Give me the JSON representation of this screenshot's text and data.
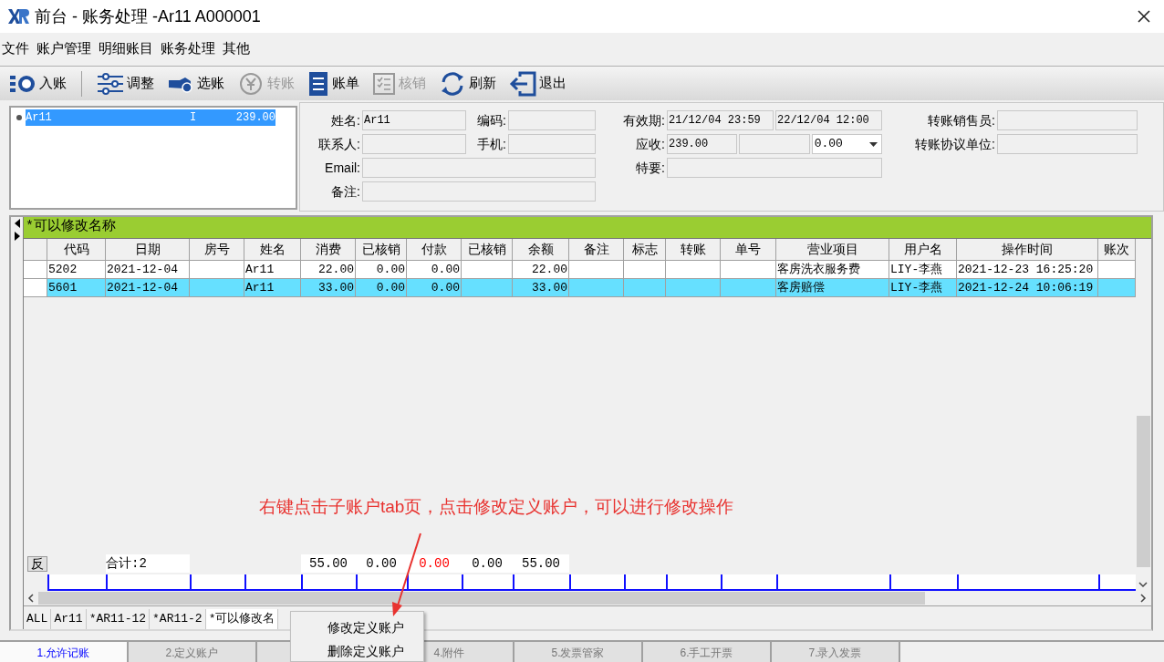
{
  "window": {
    "title": "前台 - 账务处理 -Ar11  A000001"
  },
  "menu": [
    "文件",
    "账户管理",
    "明细账目",
    "账务处理",
    "其他"
  ],
  "toolbar": [
    {
      "label": "入账",
      "disabled": false
    },
    {
      "label": "调整",
      "disabled": false
    },
    {
      "label": "选账",
      "disabled": false
    },
    {
      "label": "转账",
      "disabled": true
    },
    {
      "label": "账单",
      "disabled": false
    },
    {
      "label": "核销",
      "disabled": true
    },
    {
      "label": "刷新",
      "disabled": false
    },
    {
      "label": "退出",
      "disabled": false
    }
  ],
  "account_list": [
    {
      "name": "Ar11",
      "flag": "I",
      "amount": "239.00",
      "selected": true
    }
  ],
  "form": {
    "groups": [
      [
        {
          "label": "姓名:",
          "kind": "normal",
          "inputs": [
            {
              "kind": "text",
              "value": "Ar11"
            }
          ]
        },
        {
          "label": "联系人:",
          "kind": "normal",
          "inputs": [
            {
              "kind": "text"
            }
          ]
        },
        {
          "label": "Email:",
          "kind": "wide",
          "inputs": [
            {
              "kind": "text"
            }
          ]
        },
        {
          "label": "备注:",
          "kind": "wide",
          "inputs": [
            {
              "kind": "text"
            }
          ]
        }
      ],
      [
        {
          "label": "编码:",
          "kind": "normal",
          "inputs": [
            {
              "kind": "text"
            }
          ]
        },
        {
          "label": "手机:",
          "kind": "normal",
          "inputs": [
            {
              "kind": "text"
            }
          ]
        }
      ],
      [
        {
          "label": "有效期:",
          "kind": "normal",
          "inputs": [
            {
              "kind": "text",
              "value": "21/12/04 23:59"
            },
            {
              "kind": "text",
              "value": "22/12/04 12:00"
            }
          ]
        },
        {
          "label": "应收:",
          "kind": "normal",
          "inputs": [
            {
              "kind": "text",
              "value": "239.00"
            },
            {
              "kind": "text"
            },
            {
              "kind": "dropdown",
              "value": "0.00"
            }
          ]
        },
        {
          "label": "特要:",
          "kind": "normal",
          "inputs": [
            {
              "kind": "text"
            }
          ]
        }
      ],
      [
        {
          "label": "转账销售员:",
          "kind": "normal",
          "inputs": [
            {
              "kind": "text"
            }
          ]
        },
        {
          "label": "转账协议单位:",
          "kind": "normal",
          "inputs": [
            {
              "kind": "text"
            }
          ]
        }
      ]
    ]
  },
  "grid": {
    "title": "*可以修改名称",
    "columns": [
      {
        "label": "代码",
        "kind": "text"
      },
      {
        "label": "日期",
        "kind": "text"
      },
      {
        "label": "房号",
        "kind": "text"
      },
      {
        "label": "姓名",
        "kind": "text"
      },
      {
        "label": "消费",
        "kind": "number"
      },
      {
        "label": "已核销",
        "kind": "number"
      },
      {
        "label": "付款",
        "kind": "number"
      },
      {
        "label": "已核销",
        "kind": "number"
      },
      {
        "label": "余额",
        "kind": "number"
      },
      {
        "label": "备注",
        "kind": "text"
      },
      {
        "label": "标志",
        "kind": "text"
      },
      {
        "label": "转账",
        "kind": "text"
      },
      {
        "label": "单号",
        "kind": "text"
      },
      {
        "label": "营业项目",
        "kind": "text"
      },
      {
        "label": "用户名",
        "kind": "text"
      },
      {
        "label": "操作时间",
        "kind": "text"
      },
      {
        "label": "账次",
        "kind": "text"
      }
    ],
    "rows": [
      {
        "selected": false,
        "cells": [
          "5202",
          "2021-12-04",
          "",
          "Ar11",
          "22.00",
          "0.00",
          "0.00",
          "",
          "22.00",
          "",
          "",
          "",
          "",
          "客房洗衣服务费",
          "LIY-李燕",
          "2021-12-23 16:25:20",
          ""
        ]
      },
      {
        "selected": true,
        "cells": [
          "5601",
          "2021-12-04",
          "",
          "Ar11",
          "33.00",
          "0.00",
          "0.00",
          "",
          "33.00",
          "",
          "",
          "",
          "",
          "客房赔偿",
          "LIY-李燕",
          "2021-12-24 10:06:19",
          ""
        ]
      }
    ],
    "totals": {
      "button": "反",
      "label": "合计:2",
      "values": [
        {
          "value": "55.00",
          "color": "#000000"
        },
        {
          "value": "0.00",
          "color": "#000000"
        },
        {
          "value": "0.00",
          "color": "#ff0000"
        },
        {
          "value": "0.00",
          "color": "#000000"
        },
        {
          "value": "55.00",
          "color": "#000000"
        }
      ]
    }
  },
  "annotation": "右键点击子账户tab页，点击修改定义账户，可以进行修改操作",
  "sub_tabs": [
    {
      "label": "ALL",
      "selected": false
    },
    {
      "label": "Ar11",
      "selected": false
    },
    {
      "label": "*AR11-12",
      "selected": false
    },
    {
      "label": "*AR11-2",
      "selected": false
    },
    {
      "label": "*可以修改名",
      "selected": true
    }
  ],
  "context_menu": [
    "修改定义账户",
    "删除定义账户"
  ],
  "bottom_tabs": [
    {
      "label": "1.允许记账",
      "selected": true
    },
    {
      "label": "2.定义账户",
      "selected": false
    },
    {
      "selected": false
    },
    {
      "label": "4.附件",
      "selected": false
    },
    {
      "label": "5.发票管家",
      "selected": false
    },
    {
      "label": "6.手工开票",
      "selected": false
    },
    {
      "label": "7.录入发票",
      "selected": false
    }
  ]
}
